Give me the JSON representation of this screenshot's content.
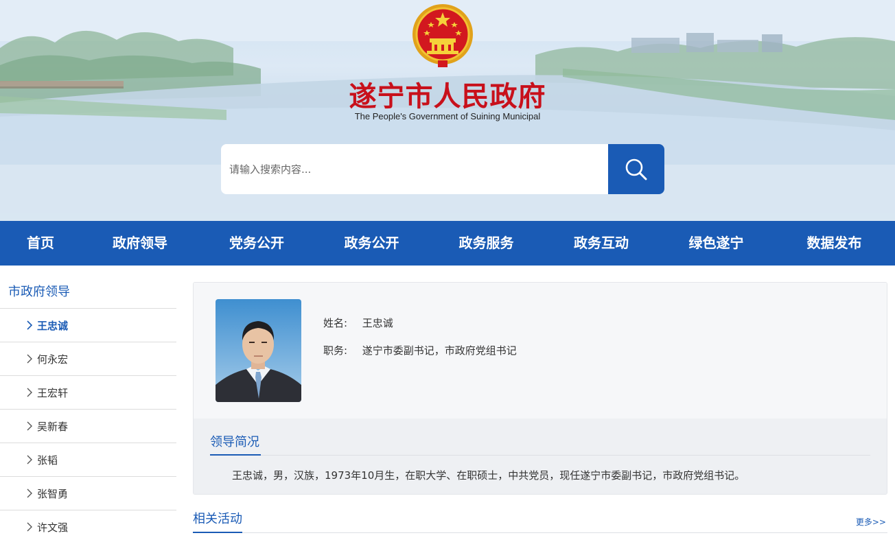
{
  "header": {
    "site_title": "遂宁市人民政府",
    "site_subtitle": "The People's Government of Suining Municipal",
    "search_placeholder": "请输入搜索内容...",
    "colors": {
      "title_red": "#c8101b",
      "brand_blue": "#1a5bb5"
    }
  },
  "nav": {
    "items": [
      {
        "label": "首页"
      },
      {
        "label": "政府领导"
      },
      {
        "label": "党务公开"
      },
      {
        "label": "政务公开"
      },
      {
        "label": "政务服务"
      },
      {
        "label": "政务互动"
      },
      {
        "label": "绿色遂宁"
      },
      {
        "label": "数据发布"
      }
    ]
  },
  "sidebar": {
    "title": "市政府领导",
    "items": [
      {
        "label": "王忠诚",
        "active": true
      },
      {
        "label": "何永宏"
      },
      {
        "label": "王宏轩"
      },
      {
        "label": "吴新春"
      },
      {
        "label": "张韬"
      },
      {
        "label": "张智勇"
      },
      {
        "label": "许文强"
      }
    ]
  },
  "profile": {
    "name_label": "姓名:",
    "name": "王忠诚",
    "position_label": "职务:",
    "position": "遂宁市委副书记，市政府党组书记",
    "brief_title": "领导简况",
    "brief_text": "王忠诚，男，汉族，1973年10月生，在职大学、在职硕士，中共党员，现任遂宁市委副书记，市政府党组书记。"
  },
  "related": {
    "title": "相关活动",
    "more_label": "更多>>"
  },
  "icons": {
    "search": "search-icon",
    "chevron": "chevron-right-icon",
    "emblem": "national-emblem-icon"
  }
}
